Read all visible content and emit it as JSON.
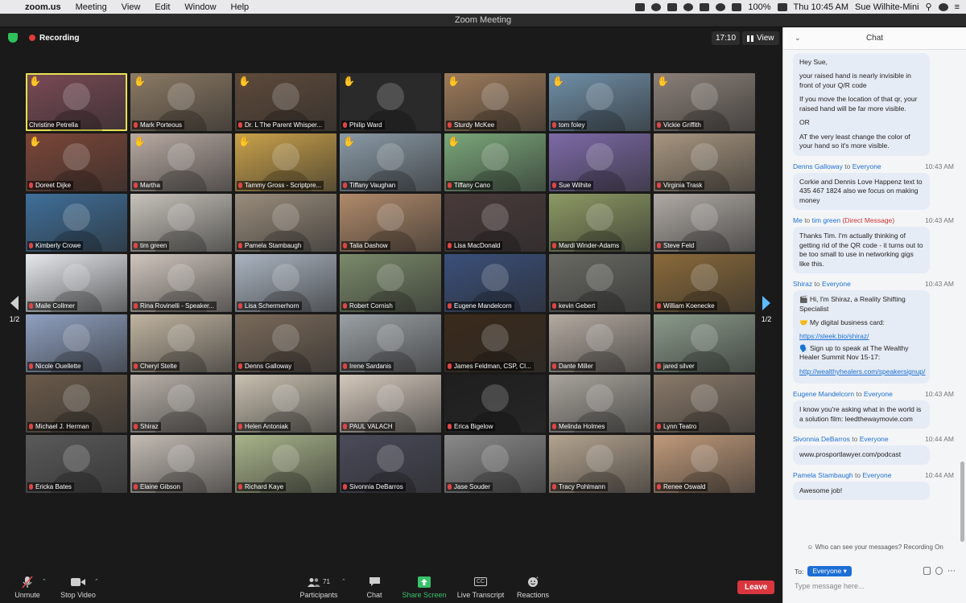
{
  "menubar": {
    "app": "zoom.us",
    "items": [
      "Meeting",
      "View",
      "Edit",
      "Window",
      "Help"
    ],
    "battery": "100%",
    "clock": "Thu 10:45 AM",
    "user": "Sue Wilhite-Mini"
  },
  "window": {
    "title": "Zoom Meeting"
  },
  "meeting": {
    "recording_label": "Recording",
    "timer": "17:10",
    "view_label": "View",
    "page_left": "1/2",
    "page_right": "1/2"
  },
  "participants": [
    {
      "name": "Christine Petrella",
      "hand": true,
      "muted": false,
      "active": true,
      "bg": "#7a4a55"
    },
    {
      "name": "Mark Porteous",
      "hand": true,
      "muted": true,
      "bg": "#8c7a64"
    },
    {
      "name": "Dr. L The Parent Whisper...",
      "hand": true,
      "muted": true,
      "bg": "#5e4a3a"
    },
    {
      "name": "Philip Ward",
      "hand": true,
      "muted": true,
      "bg": "#2a2a2a"
    },
    {
      "name": "Sturdy McKee",
      "hand": true,
      "muted": true,
      "bg": "#9c7a5a"
    },
    {
      "name": "tom foley",
      "hand": true,
      "muted": true,
      "bg": "#6f8fa8"
    },
    {
      "name": "Vickie Griffith",
      "hand": true,
      "muted": true,
      "bg": "#8b8078"
    },
    {
      "name": "Doreet Dijke",
      "hand": true,
      "muted": true,
      "bg": "#7b4638"
    },
    {
      "name": "Martha",
      "hand": true,
      "muted": true,
      "bg": "#b8aaa2"
    },
    {
      "name": "Tammy Gross - Scriptpre...",
      "hand": true,
      "muted": true,
      "bg": "#c9a14a"
    },
    {
      "name": "Tiffany Vaughan",
      "hand": true,
      "muted": true,
      "bg": "#8a9aa6"
    },
    {
      "name": "Tiffany Cano",
      "hand": true,
      "muted": true,
      "bg": "#7aa77a"
    },
    {
      "name": "Sue Wilhite",
      "hand": false,
      "muted": true,
      "bg": "#7d6aa8"
    },
    {
      "name": "Virginia Trask",
      "hand": false,
      "muted": true,
      "bg": "#a89680"
    },
    {
      "name": "Kimberly Crowe",
      "hand": false,
      "muted": true,
      "bg": "#3f6f9a"
    },
    {
      "name": "tim green",
      "hand": false,
      "muted": true,
      "bg": "#c7c3bb"
    },
    {
      "name": "Pamela Stambaugh",
      "hand": false,
      "muted": true,
      "bg": "#9a8d7c"
    },
    {
      "name": "Talia Dashow",
      "hand": false,
      "muted": true,
      "bg": "#b08a6a"
    },
    {
      "name": "Lisa MacDonald",
      "hand": false,
      "muted": true,
      "bg": "#4a3a3a"
    },
    {
      "name": "Mardi Winder-Adams",
      "hand": false,
      "muted": true,
      "bg": "#8d9a64"
    },
    {
      "name": "Steve Feld",
      "hand": false,
      "muted": true,
      "bg": "#b0aaa4"
    },
    {
      "name": "Maile Collmer",
      "hand": false,
      "muted": true,
      "bg": "#e6e8ec"
    },
    {
      "name": "Rina Rovinelli - Speaker...",
      "hand": false,
      "muted": true,
      "bg": "#cfc5bd"
    },
    {
      "name": "Lisa Schermerhorn",
      "hand": false,
      "muted": true,
      "bg": "#aab4c0"
    },
    {
      "name": "Robert Cornish",
      "hand": false,
      "muted": true,
      "bg": "#7a8a6a"
    },
    {
      "name": "Eugene Mandelcorn",
      "hand": false,
      "muted": true,
      "bg": "#3a4f7a"
    },
    {
      "name": "kevin Gebert",
      "hand": false,
      "muted": true,
      "bg": "#6a6a64"
    },
    {
      "name": "William Koenecke",
      "hand": false,
      "muted": true,
      "bg": "#8a6a3a"
    },
    {
      "name": "Nicole Ouellette",
      "hand": false,
      "muted": true,
      "bg": "#8fa0c0"
    },
    {
      "name": "Cheryl Stelte",
      "hand": false,
      "muted": true,
      "bg": "#c0b4a0"
    },
    {
      "name": "Denns Galloway",
      "hand": false,
      "muted": true,
      "bg": "#7a6a5a"
    },
    {
      "name": "Irene Sardanis",
      "hand": false,
      "muted": true,
      "bg": "#9aa0a4"
    },
    {
      "name": "James Feldman, CSP, CI...",
      "hand": false,
      "muted": true,
      "bg": "#3a2a1a"
    },
    {
      "name": "Dante Miller",
      "hand": false,
      "muted": true,
      "bg": "#b4aaa0"
    },
    {
      "name": "jared silver",
      "hand": false,
      "muted": true,
      "bg": "#8a9a8a"
    },
    {
      "name": "Michael J. Herman",
      "hand": false,
      "muted": true,
      "bg": "#6a5a4a"
    },
    {
      "name": "Shiraz",
      "hand": false,
      "muted": true,
      "bg": "#b8b0a8"
    },
    {
      "name": "Helen Antoniak",
      "hand": false,
      "muted": true,
      "bg": "#c8c0b0"
    },
    {
      "name": "PAUL VALACH",
      "hand": false,
      "muted": true,
      "bg": "#d4c8bc"
    },
    {
      "name": "Erica Bigelow",
      "hand": false,
      "muted": true,
      "bg": "#1e1e1e"
    },
    {
      "name": "Melinda Holmes",
      "hand": false,
      "muted": true,
      "bg": "#a8a49c"
    },
    {
      "name": "Lynn Teatro",
      "hand": false,
      "muted": true,
      "bg": "#8a7a6a"
    },
    {
      "name": "Ericka Bates",
      "hand": false,
      "muted": true,
      "bg": "#5a5a5a"
    },
    {
      "name": "Elaine Gibson",
      "hand": false,
      "muted": true,
      "bg": "#c4bcb4"
    },
    {
      "name": "Richard Kaye",
      "hand": false,
      "muted": true,
      "bg": "#a8b48a"
    },
    {
      "name": "Sivonnia DeBarros",
      "hand": false,
      "muted": true,
      "bg": "#4a4a5a"
    },
    {
      "name": "Jase Souder",
      "hand": false,
      "muted": true,
      "bg": "#8a8a8a"
    },
    {
      "name": "Tracy Pohlmann",
      "hand": false,
      "muted": true,
      "bg": "#b4a490"
    },
    {
      "name": "Renee Oswald",
      "hand": false,
      "muted": true,
      "bg": "#c09a7a"
    }
  ],
  "toolbar": {
    "unmute": "Unmute",
    "stop_video": "Stop Video",
    "participants": "Participants",
    "participants_count": "71",
    "chat": "Chat",
    "share": "Share Screen",
    "transcript": "Live Transcript",
    "transcript_badge": "CC",
    "reactions": "Reactions",
    "leave": "Leave"
  },
  "chat": {
    "title": "Chat",
    "messages": [
      {
        "from": "",
        "to": "",
        "time": "",
        "lines": [
          "Hey Sue,",
          "your raised hand is nearly invisible in front of your Q/R code",
          "If you move the location of that qr, your raised hand will be far more visible.",
          "OR",
          "AT the very least change the color of your hand so it's more visible."
        ]
      },
      {
        "from": "Denns Galloway",
        "to": "Everyone",
        "dm": "",
        "time": "10:43 AM",
        "lines": [
          "Corkie and Dennis Love Happenz text to 435 467 1824 also we focus on making money"
        ]
      },
      {
        "from": "Me",
        "to": "tim green",
        "dm": "(Direct Message)",
        "time": "10:43 AM",
        "lines": [
          "Thanks Tim. I'm actually thinking of getting rid of the QR code - it turns out to be too small to use in networking gigs like this."
        ]
      },
      {
        "from": "Shiraz",
        "to": "Everyone",
        "dm": "",
        "time": "10:43 AM",
        "lines": [
          "🎬 Hi, I'm Shiraz, a Reality Shifting Specialist",
          "🤝 My digital business card:",
          "https://sleek.bio/shiraz/",
          "🗣️ Sign up to speak at The Wealthy Healer Summit Nov 15-17:",
          "http://wealthyhealers.com/speakersignup/"
        ]
      },
      {
        "from": "Eugene Mandelcorn",
        "to": "Everyone",
        "dm": "",
        "time": "10:43 AM",
        "lines": [
          "I know you're asking what in the world is a solution film: leedthewaymovie.com"
        ]
      },
      {
        "from": "Sivonnia DeBarros",
        "to": "Everyone",
        "dm": "",
        "time": "10:44 AM",
        "lines": [
          "www.prosportlawyer.com/podcast"
        ]
      },
      {
        "from": "Pamela Stambaugh",
        "to": "Everyone",
        "dm": "",
        "time": "10:44 AM",
        "lines": [
          "Awesome job!"
        ]
      }
    ],
    "to_word": "to",
    "who_can_see": "Who can see your messages? Recording On",
    "to_label": "To:",
    "recipient": "Everyone",
    "input_placeholder": "Type message here..."
  },
  "colors": {
    "leave": "#d9363e",
    "share": "#39c26a",
    "link": "#1d6fd6",
    "recording": "#e03b3b",
    "active_speaker": "#e6e24d"
  }
}
